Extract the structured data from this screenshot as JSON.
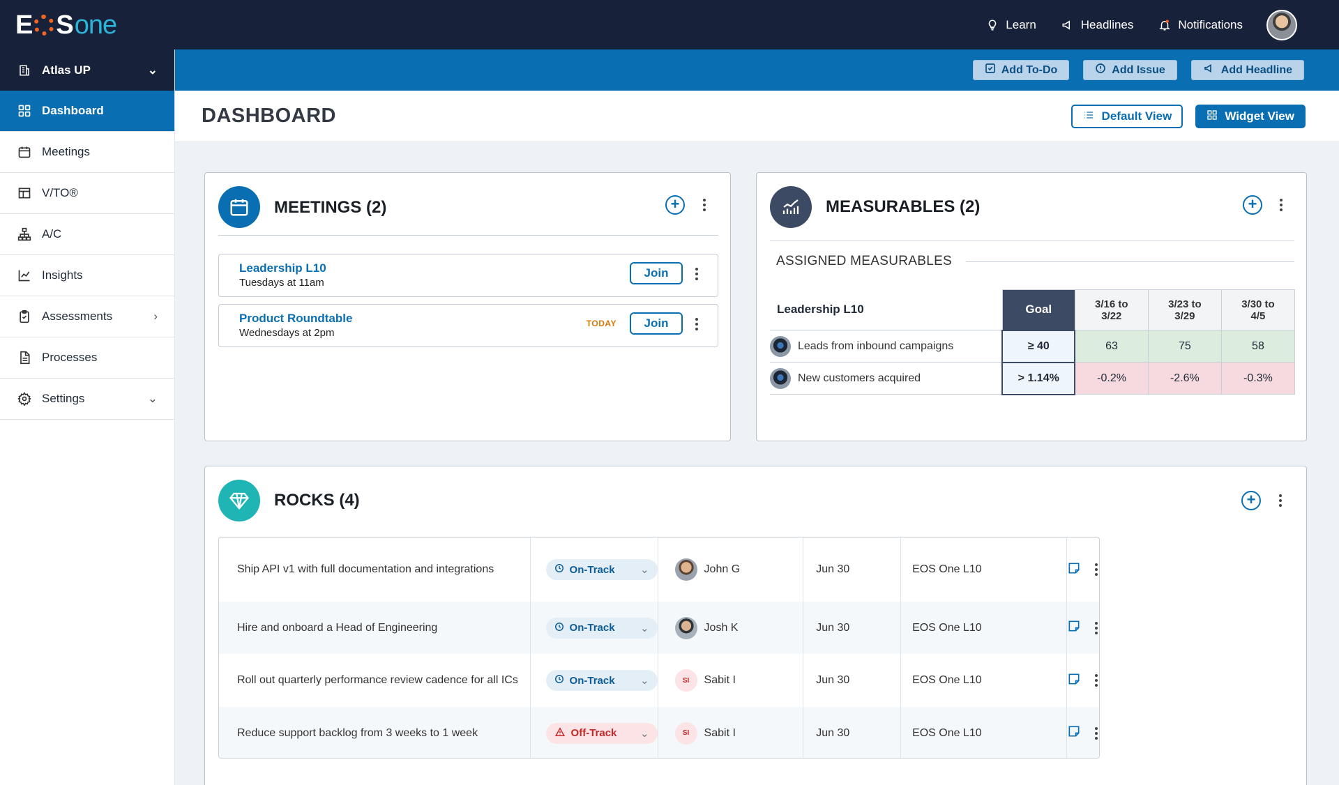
{
  "brand": {
    "logo_text": "EOSone"
  },
  "topnav": {
    "learn": "Learn",
    "headlines": "Headlines",
    "notifications": "Notifications"
  },
  "org": {
    "name": "Atlas UP"
  },
  "sidebar": {
    "items": [
      {
        "label": "Dashboard",
        "icon": "grid-icon"
      },
      {
        "label": "Meetings",
        "icon": "calendar-icon"
      },
      {
        "label": "V/TO®",
        "icon": "vto-icon"
      },
      {
        "label": "A/C",
        "icon": "org-chart-icon"
      },
      {
        "label": "Insights",
        "icon": "chart-icon"
      },
      {
        "label": "Assessments",
        "icon": "clipboard-icon"
      },
      {
        "label": "Processes",
        "icon": "document-icon"
      },
      {
        "label": "Settings",
        "icon": "gear-icon"
      }
    ]
  },
  "actions": {
    "add_todo": "Add To-Do",
    "add_issue": "Add Issue",
    "add_headline": "Add Headline"
  },
  "page": {
    "title": "DASHBOARD",
    "default_view": "Default View",
    "widget_view": "Widget View"
  },
  "meetings": {
    "title": "MEETINGS (2)",
    "items": [
      {
        "name": "Leadership L10",
        "time": "Tuesdays at 11am",
        "join": "Join",
        "badge": ""
      },
      {
        "name": "Product Roundtable",
        "time": "Wednesdays at 2pm",
        "join": "Join",
        "badge": "TODAY"
      }
    ]
  },
  "measurables": {
    "title": "MEASURABLES (2)",
    "section": "ASSIGNED MEASURABLES",
    "meeting": "Leadership L10",
    "goal_header": "Goal",
    "weeks": [
      {
        "l1": "3/16 to",
        "l2": "3/22"
      },
      {
        "l1": "3/23 to",
        "l2": "3/29"
      },
      {
        "l1": "3/30 to",
        "l2": "4/5"
      }
    ],
    "rows": [
      {
        "name": "Leads from inbound campaigns",
        "goal": "≥ 40",
        "values": [
          "63",
          "75",
          "58"
        ],
        "status": "green"
      },
      {
        "name": "New customers acquired",
        "goal": "> 1.14%",
        "values": [
          "-0.2%",
          "-2.6%",
          "-0.3%"
        ],
        "status": "red"
      }
    ]
  },
  "rocks": {
    "title": "ROCKS (4)",
    "rows": [
      {
        "title": "Ship API v1 with full documentation and integrations",
        "status": "On-Track",
        "owner": "John G",
        "initials": "",
        "due": "Jun 30",
        "meeting": "EOS One L10"
      },
      {
        "title": "Hire and onboard a Head of Engineering",
        "status": "On-Track",
        "owner": "Josh K",
        "initials": "",
        "due": "Jun 30",
        "meeting": "EOS One L10"
      },
      {
        "title": "Roll out quarterly performance review cadence for all ICs",
        "status": "On-Track",
        "owner": "Sabit I",
        "initials": "SI",
        "due": "Jun 30",
        "meeting": "EOS One L10"
      },
      {
        "title": "Reduce support backlog from 3 weeks to 1 week",
        "status": "Off-Track",
        "owner": "Sabit I",
        "initials": "SI",
        "due": "Jun 30",
        "meeting": "EOS One L10"
      }
    ]
  },
  "colors": {
    "navy": "#17223a",
    "primary": "#0a6fb2",
    "orange": "#f26522",
    "teal": "#1fb5b5"
  }
}
